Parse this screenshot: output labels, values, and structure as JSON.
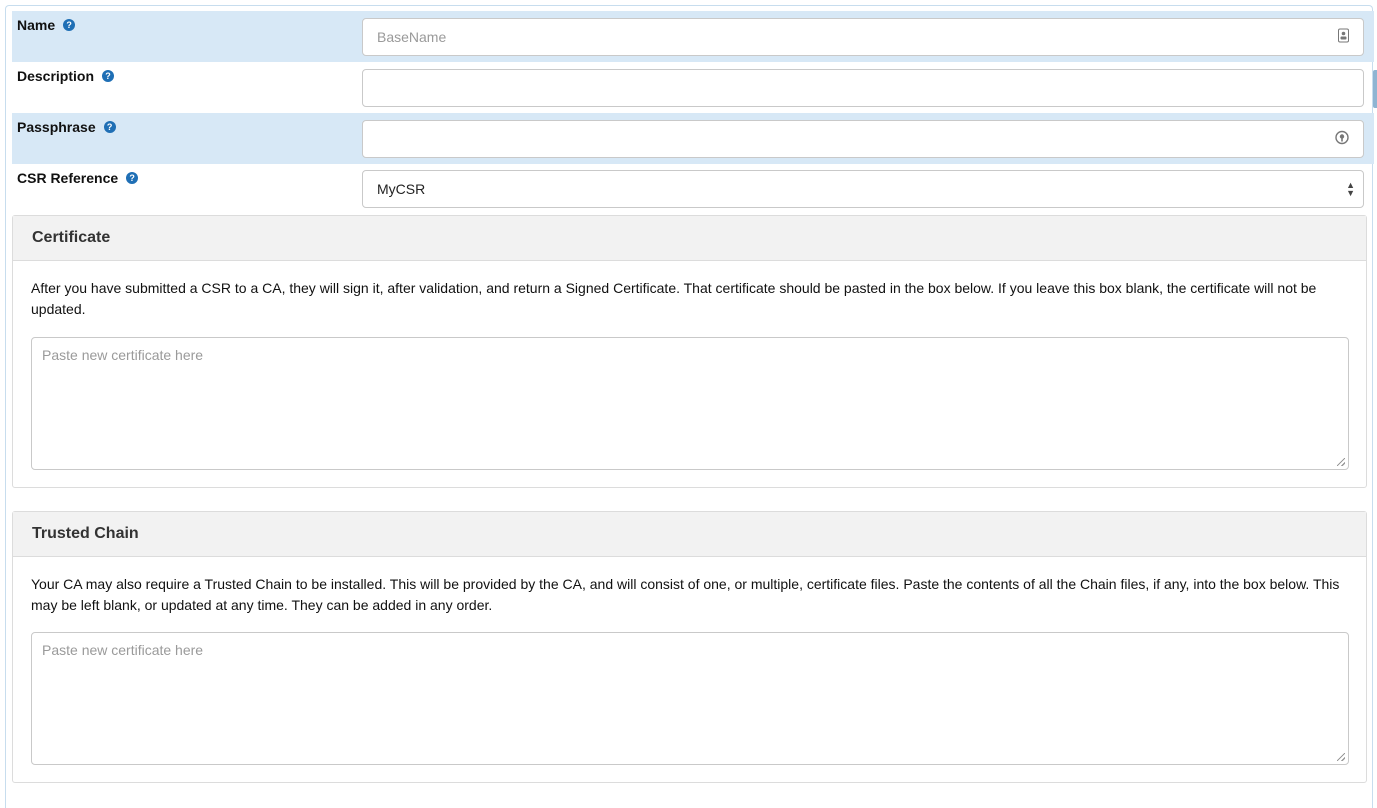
{
  "form": {
    "name": {
      "label": "Name",
      "placeholder": "BaseName",
      "value": ""
    },
    "description": {
      "label": "Description",
      "value": ""
    },
    "passphrase": {
      "label": "Passphrase",
      "value": ""
    },
    "csr_reference": {
      "label": "CSR Reference",
      "selected": "MyCSR"
    }
  },
  "help_glyph": "?",
  "certificate": {
    "title": "Certificate",
    "text": "After you have submitted a CSR to a CA, they will sign it, after validation, and return a Signed Certificate. That certificate should be pasted in the box below. If you leave this box blank, the certificate will not be updated.",
    "placeholder": "Paste new certificate here"
  },
  "trusted_chain": {
    "title": "Trusted Chain",
    "text": "Your CA may also require a Trusted Chain to be installed. This will be provided by the CA, and will consist of one, or multiple, certificate files. Paste the contents of all the Chain files, if any, into the box below. This may be left blank, or updated at any time. They can be added in any order.",
    "placeholder": "Paste new certificate here"
  },
  "colors": {
    "highlight_row": "#d7e8f6",
    "help_icon": "#1f6fb5",
    "panel_header": "#f2f2f2"
  }
}
